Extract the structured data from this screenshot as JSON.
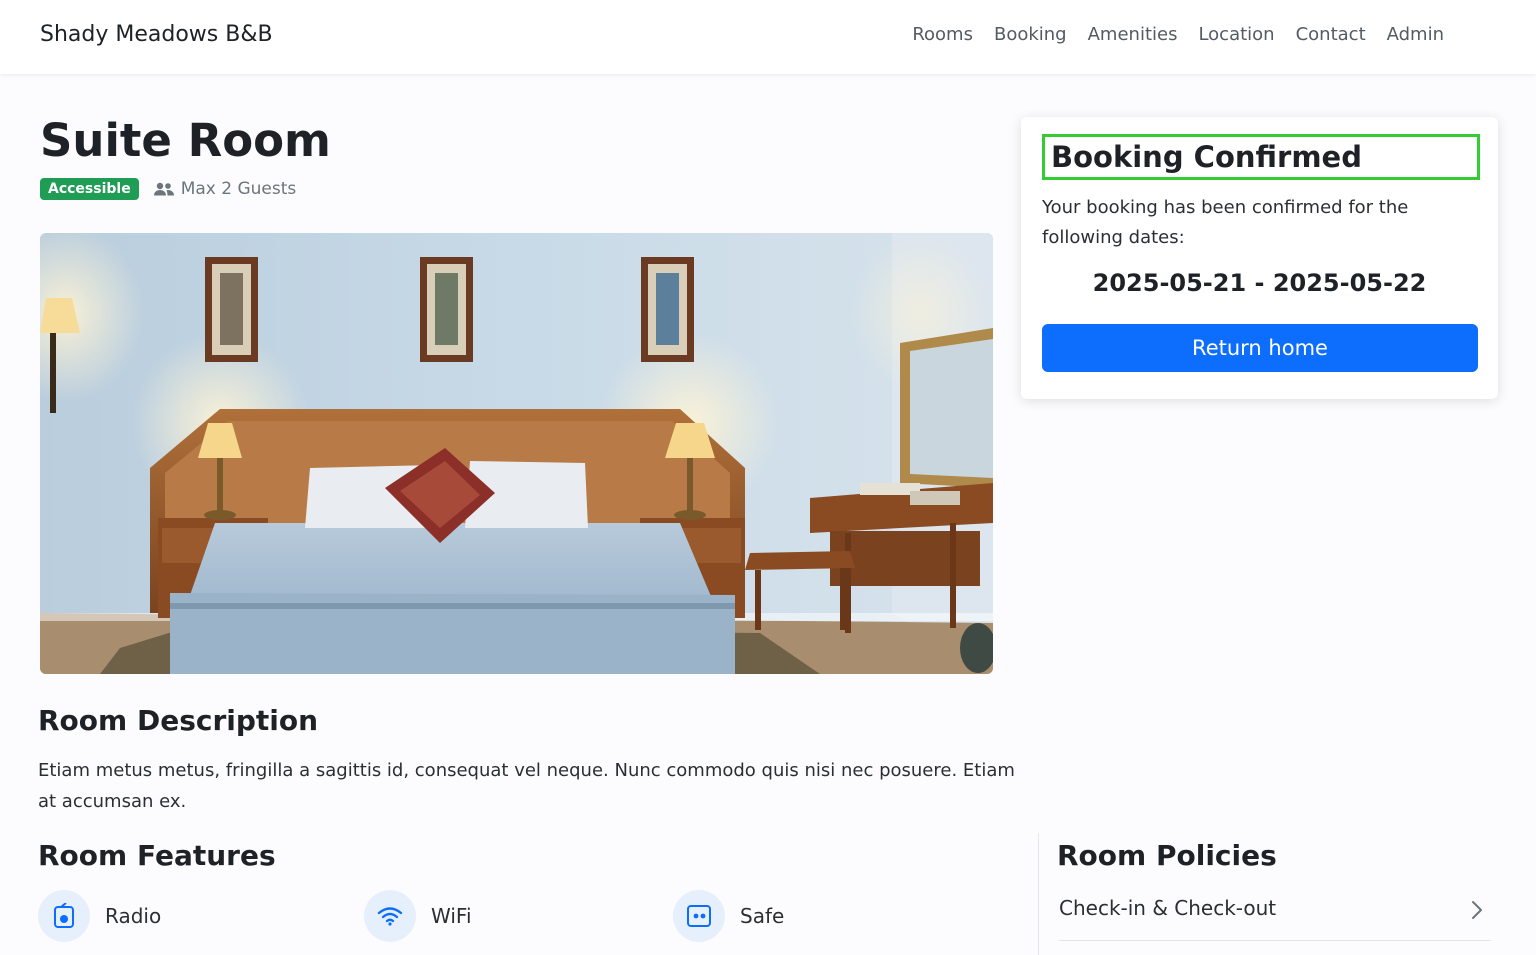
{
  "navbar": {
    "brand": "Shady Meadows B&B",
    "links": [
      "Rooms",
      "Booking",
      "Amenities",
      "Location",
      "Contact",
      "Admin"
    ]
  },
  "room": {
    "title": "Suite Room",
    "badge": "Accessible",
    "guests": "Max 2 Guests",
    "description_heading": "Room Description",
    "description": "Etiam metus metus, fringilla a sagittis id, consequat vel neque. Nunc commodo quis nisi nec posuere. Etiam at accumsan ex."
  },
  "booking": {
    "title": "Booking Confirmed",
    "message": "Your booking has been confirmed for the following dates:",
    "dates": "2025-05-21 - 2025-05-22",
    "button": "Return home"
  },
  "features": {
    "heading": "Room Features",
    "items": [
      {
        "label": "Radio",
        "icon": "radio-icon"
      },
      {
        "label": "WiFi",
        "icon": "wifi-icon"
      },
      {
        "label": "Safe",
        "icon": "safe-icon"
      }
    ]
  },
  "policies": {
    "heading": "Room Policies",
    "items": [
      "Check-in & Check-out"
    ]
  },
  "colors": {
    "accent": "#0d6efd",
    "badge": "#1f9d55",
    "confirm_border": "#33cc33"
  }
}
